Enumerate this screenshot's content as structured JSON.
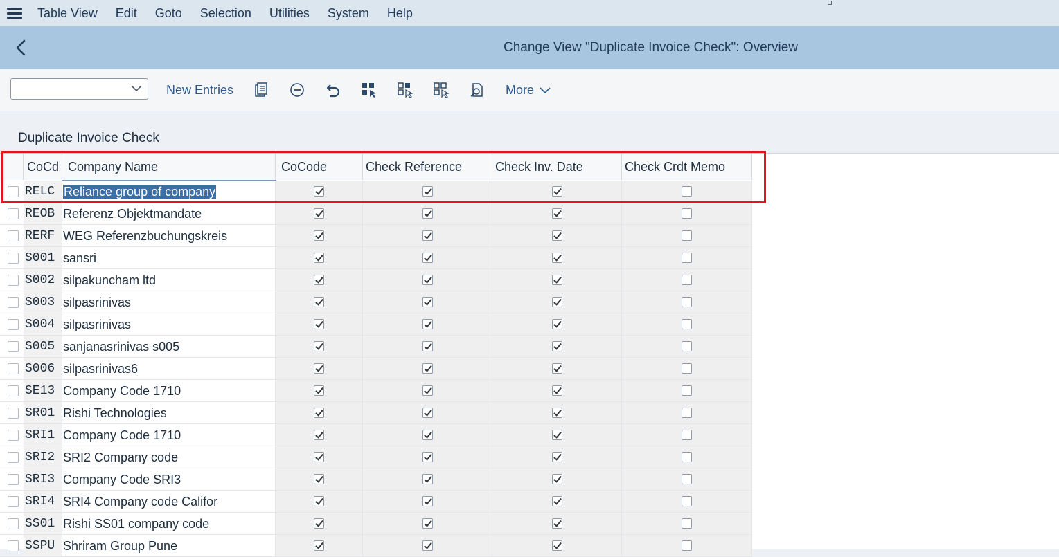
{
  "menu": {
    "items": [
      "Table View",
      "Edit",
      "Goto",
      "Selection",
      "Utilities",
      "System",
      "Help"
    ]
  },
  "titlebar": {
    "title": "Change View \"Duplicate Invoice Check\": Overview"
  },
  "toolbar": {
    "new_entries": "New Entries",
    "more": "More"
  },
  "section": {
    "title": "Duplicate Invoice Check"
  },
  "table": {
    "columns": [
      "CoCd",
      "Company Name",
      "CoCode",
      "Check Reference",
      "Check Inv. Date",
      "Check Crdt Memo"
    ],
    "rows": [
      {
        "code": "RELC",
        "name": "Reliance group of company",
        "cocode": true,
        "ref": true,
        "date": true,
        "memo": false
      },
      {
        "code": "REOB",
        "name": "Referenz Objektmandate",
        "cocode": true,
        "ref": true,
        "date": true,
        "memo": false
      },
      {
        "code": "RERF",
        "name": "WEG Referenzbuchungskreis",
        "cocode": true,
        "ref": true,
        "date": true,
        "memo": false
      },
      {
        "code": "S001",
        "name": "sansri",
        "cocode": true,
        "ref": true,
        "date": true,
        "memo": false
      },
      {
        "code": "S002",
        "name": "silpakuncham ltd",
        "cocode": true,
        "ref": true,
        "date": true,
        "memo": false
      },
      {
        "code": "S003",
        "name": "silpasrinivas",
        "cocode": true,
        "ref": true,
        "date": true,
        "memo": false
      },
      {
        "code": "S004",
        "name": "silpasrinivas",
        "cocode": true,
        "ref": true,
        "date": true,
        "memo": false
      },
      {
        "code": "S005",
        "name": "sanjanasrinivas s005",
        "cocode": true,
        "ref": true,
        "date": true,
        "memo": false
      },
      {
        "code": "S006",
        "name": "silpasrinivas6",
        "cocode": true,
        "ref": true,
        "date": true,
        "memo": false
      },
      {
        "code": "SE13",
        "name": "Company Code 1710",
        "cocode": true,
        "ref": true,
        "date": true,
        "memo": false
      },
      {
        "code": "SR01",
        "name": "Rishi Technologies",
        "cocode": true,
        "ref": true,
        "date": true,
        "memo": false
      },
      {
        "code": "SRI1",
        "name": "Company Code 1710",
        "cocode": true,
        "ref": true,
        "date": true,
        "memo": false
      },
      {
        "code": "SRI2",
        "name": "SRI2 Company code",
        "cocode": true,
        "ref": true,
        "date": true,
        "memo": false
      },
      {
        "code": "SRI3",
        "name": "Company Code SRI3",
        "cocode": true,
        "ref": true,
        "date": true,
        "memo": false
      },
      {
        "code": "SRI4",
        "name": "SRI4 Company code Califor",
        "cocode": true,
        "ref": true,
        "date": true,
        "memo": false
      },
      {
        "code": "SS01",
        "name": "Rishi SS01 company code",
        "cocode": true,
        "ref": true,
        "date": true,
        "memo": false
      },
      {
        "code": "SSPU",
        "name": "Shriram Group Pune",
        "cocode": true,
        "ref": true,
        "date": true,
        "memo": false
      }
    ]
  },
  "colors": {
    "highlight": "#e4141e",
    "titlebar": "#a9c6e1",
    "menubar": "#dce6ef"
  }
}
